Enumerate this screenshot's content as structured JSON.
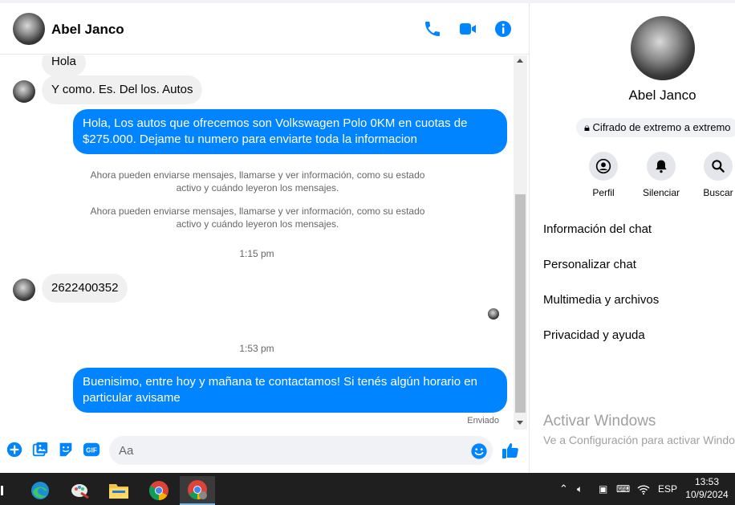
{
  "chat": {
    "contact_name": "Abel Janco",
    "messages": [
      {
        "from": "them",
        "text": "Hola"
      },
      {
        "from": "them",
        "text": "Y como. Es. Del los. Autos"
      },
      {
        "from": "me",
        "text": "Hola, Los autos que ofrecemos son Volkswagen Polo 0KM en cuotas de $275.000. Dejame tu numero para enviarte toda la informacion"
      },
      {
        "from": "system",
        "text": "Ahora pueden enviarse mensajes, llamarse y ver información, como su estado activo y cuándo leyeron los mensajes."
      },
      {
        "from": "system",
        "text": "Ahora pueden enviarse mensajes, llamarse y ver información, como su estado activo y cuándo leyeron los mensajes."
      },
      {
        "from": "time",
        "text": "1:15 pm"
      },
      {
        "from": "them",
        "text": "2622400352"
      },
      {
        "from": "time",
        "text": "1:53 pm"
      },
      {
        "from": "me",
        "text": "Buenisimo, entre hoy y mañana te contactamos! Si tenés algún horario en particular avisame"
      }
    ],
    "status": "Enviado",
    "composer_placeholder": "Aa",
    "accent_color": "#0084ff"
  },
  "side_panel": {
    "name": "Abel Janco",
    "encryption_badge": "Cifrado de extremo a extremo",
    "actions": [
      {
        "label": "Perfil",
        "icon": "profile-icon"
      },
      {
        "label": "Silenciar",
        "icon": "bell-icon"
      },
      {
        "label": "Buscar",
        "icon": "search-icon"
      }
    ],
    "menu": [
      "Información del chat",
      "Personalizar chat",
      "Multimedia y archivos",
      "Privacidad y ayuda"
    ],
    "watermark": {
      "title": "Activar Windows",
      "subtitle": "Ve a Configuración para activar Windows."
    }
  },
  "taskbar": {
    "apps": [
      "task-view-icon",
      "edge-icon",
      "paint-icon",
      "file-explorer-icon",
      "chrome-icon",
      "chrome-profile-icon"
    ],
    "language": "ESP",
    "time": "13:53",
    "date": "10/9/2024"
  }
}
